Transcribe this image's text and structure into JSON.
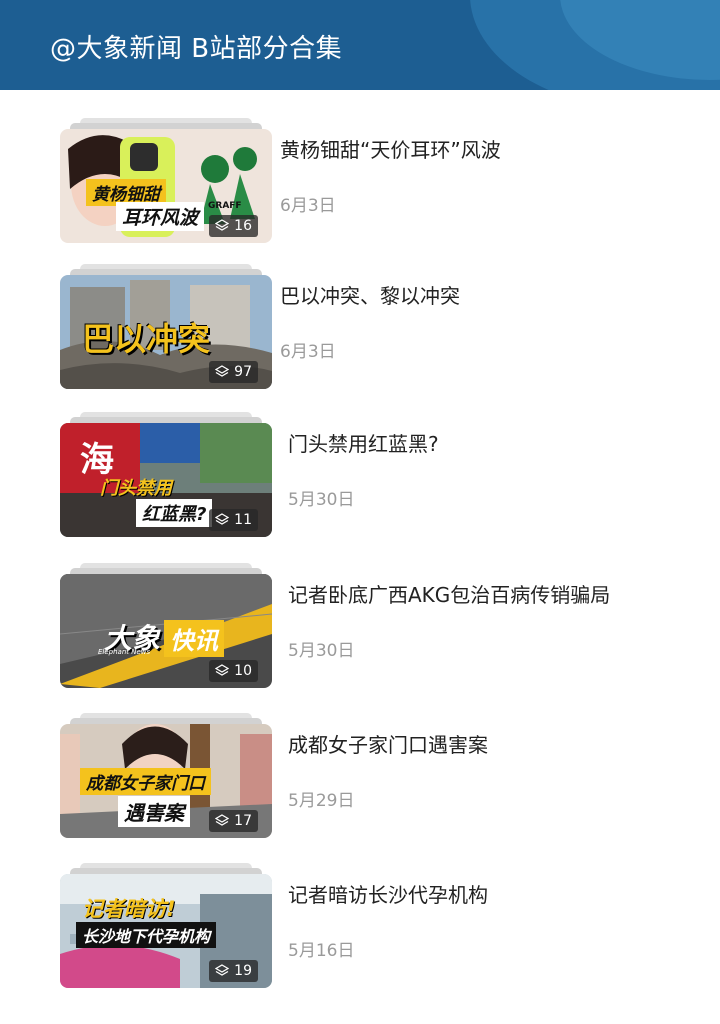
{
  "header": {
    "title": "@大象新闻 B站部分合集"
  },
  "items": [
    {
      "title": "黄杨钿甜“天价耳环”风波",
      "date": "6月3日",
      "count": "16",
      "captions": [
        "黄杨钿甜",
        "耳环风波"
      ],
      "caption_extra": "GRAFF"
    },
    {
      "title": "巴以冲突、黎以冲突",
      "date": "6月3日",
      "count": "97",
      "captions": [
        "巴以冲突"
      ]
    },
    {
      "title": "门头禁用红蓝黑?",
      "date": "5月30日",
      "count": "11",
      "captions": [
        "海",
        "门头禁用",
        "红蓝黑?"
      ]
    },
    {
      "title": "记者卧底广西AKG包治百病传销骗局",
      "date": "5月30日",
      "count": "10",
      "captions": [
        "大象",
        "快讯",
        "Elephant News"
      ]
    },
    {
      "title": "成都女子家门口遇害案",
      "date": "5月29日",
      "count": "17",
      "captions": [
        "成都女子家门口",
        "遇害案"
      ]
    },
    {
      "title": "记者暗访长沙代孕机构",
      "date": "5月16日",
      "count": "19",
      "captions": [
        "记者暗访!",
        "长沙地下代孕机构"
      ]
    }
  ],
  "colors": {
    "header_bg": "#1d5e92",
    "caption_yellow": "#f4c21d"
  }
}
